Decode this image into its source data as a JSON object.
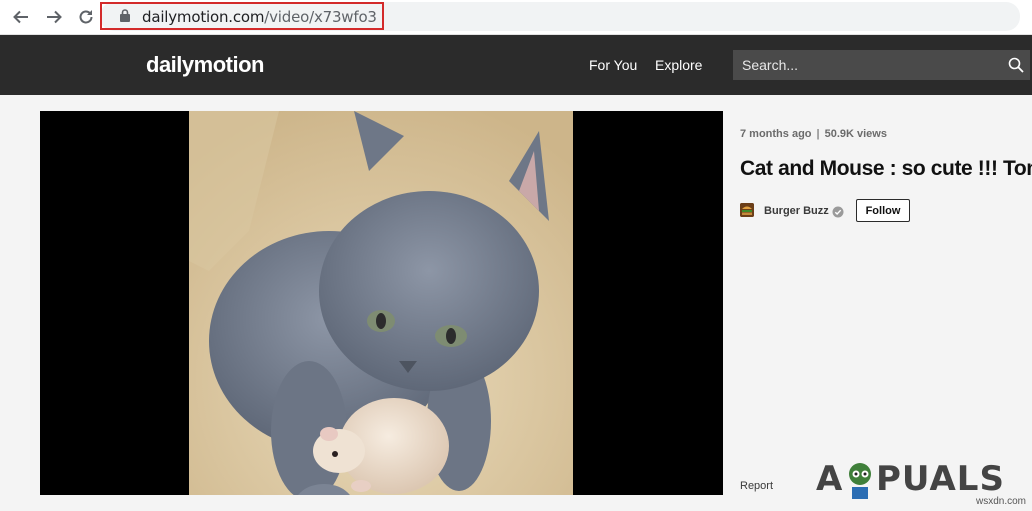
{
  "browser": {
    "url_domain": "dailymotion.com",
    "url_path": "/video/x73wfo3"
  },
  "header": {
    "logo": "dailymotion",
    "nav": [
      "For You",
      "Explore"
    ],
    "search_placeholder": "Search..."
  },
  "video": {
    "age": "7 months ago",
    "separator": "|",
    "views": "50.9K views",
    "title": "Cat and Mouse : so cute !!! Tom",
    "channel": "Burger Buzz",
    "follow_label": "Follow",
    "report_label": "Report"
  },
  "watermark": {
    "logo": "APPUALS",
    "site": "wsxdn.com"
  },
  "colors": {
    "header_bg": "#2b2b2b",
    "search_bg": "#4a4a4a",
    "url_highlight": "#d32a2a",
    "page_bg": "#f4f4f4"
  },
  "icons": [
    "back-arrow-icon",
    "forward-arrow-icon",
    "reload-icon",
    "lock-icon",
    "search-icon",
    "verified-icon"
  ]
}
